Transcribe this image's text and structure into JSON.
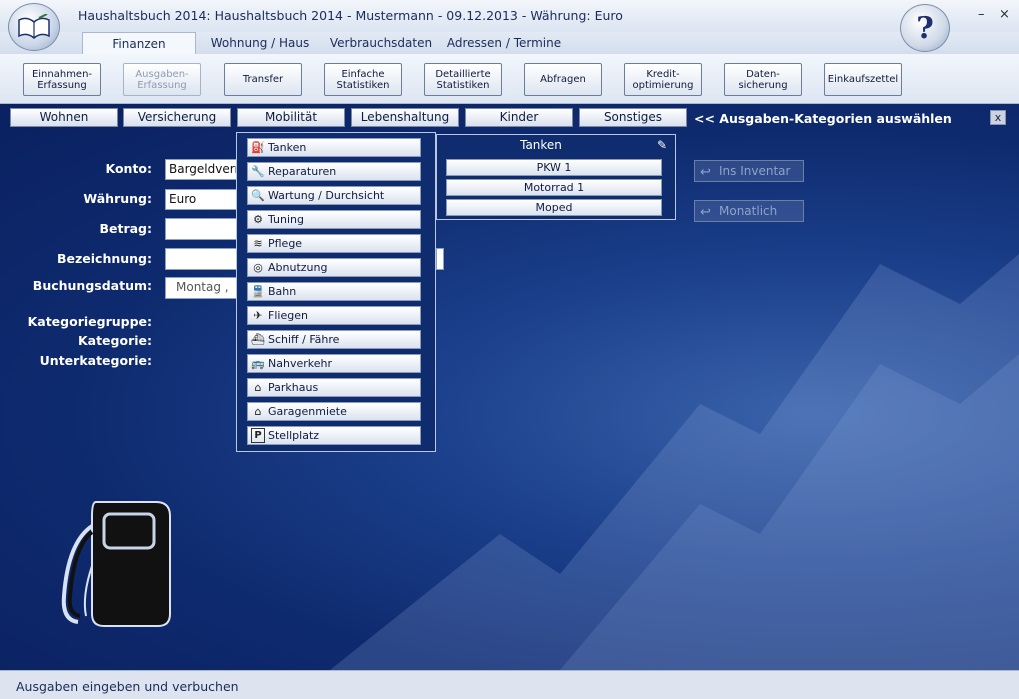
{
  "titlebar": {
    "title": "Haushaltsbuch 2014: Haushaltsbuch 2014 - Mustermann - 09.12.2013 - Währung: Euro",
    "help": "?",
    "minimize": "–",
    "close": "×"
  },
  "menu_tabs": [
    "Finanzen",
    "Wohnung / Haus",
    "Verbrauchsdaten",
    "Adressen / Termine"
  ],
  "ribbon": [
    "Einnahmen-\nErfassung",
    "Ausgaben-\nErfassung",
    "Transfer",
    "Einfache\nStatistiken",
    "Detaillierte\nStatistiken",
    "Abfragen",
    "Kredit-\noptimierung",
    "Daten-\nsicherung",
    "Einkaufszettel"
  ],
  "category_groups": [
    "Wohnen",
    "Versicherung",
    "Mobilität",
    "Lebenshaltung",
    "Kinder",
    "Sonstiges"
  ],
  "category_prompt": "<< Ausgaben-Kategorien auswählen",
  "close_panel": "x",
  "form": {
    "konto_label": "Konto:",
    "konto_value": "Bargeldverm",
    "waehrung_label": "Währung:",
    "waehrung_value": "Euro",
    "betrag_label": "Betrag:",
    "bezeichnung_label": "Bezeichnung:",
    "buchungsdatum_label": "Buchungsdatum:",
    "buchungsdatum_value": "Montag    ,",
    "kategoriegruppe_label": "Kategoriegruppe:",
    "kategorie_label": "Kategorie:",
    "unterkategorie_label": "Unterkategorie:"
  },
  "categories": [
    {
      "label": "Tanken",
      "icon": "fuel-pump-icon",
      "glyph": "⛽"
    },
    {
      "label": "Reparaturen",
      "icon": "wrench-icon",
      "glyph": "🔧"
    },
    {
      "label": "Wartung / Durchsicht",
      "icon": "magnifier-icon",
      "glyph": "🔍"
    },
    {
      "label": "Tuning",
      "icon": "engine-icon",
      "glyph": "⚙"
    },
    {
      "label": "Pflege",
      "icon": "car-wash-icon",
      "glyph": "≋"
    },
    {
      "label": "Abnutzung",
      "icon": "tire-icon",
      "glyph": "◎"
    },
    {
      "label": "Bahn",
      "icon": "train-icon",
      "glyph": "🚆"
    },
    {
      "label": "Fliegen",
      "icon": "airplane-icon",
      "glyph": "✈"
    },
    {
      "label": "Schiff / Fähre",
      "icon": "ship-icon",
      "glyph": "⛴"
    },
    {
      "label": "Nahverkehr",
      "icon": "bus-icon",
      "glyph": "🚌"
    },
    {
      "label": "Parkhaus",
      "icon": "parking-garage-icon",
      "glyph": "⌂"
    },
    {
      "label": "Garagenmiete",
      "icon": "garage-icon",
      "glyph": "⌂"
    },
    {
      "label": "Stellplatz",
      "icon": "parking-icon",
      "glyph": "P"
    }
  ],
  "subcategory": {
    "title": "Tanken",
    "items": [
      "PKW 1",
      "Motorrad 1",
      "Moped"
    ]
  },
  "right_buttons": [
    "Ins Inventar",
    "Monatlich"
  ],
  "status": "Ausgaben eingeben und verbuchen",
  "colors": {
    "background": "#0e2a6e",
    "accent": "#1a2c5a"
  }
}
